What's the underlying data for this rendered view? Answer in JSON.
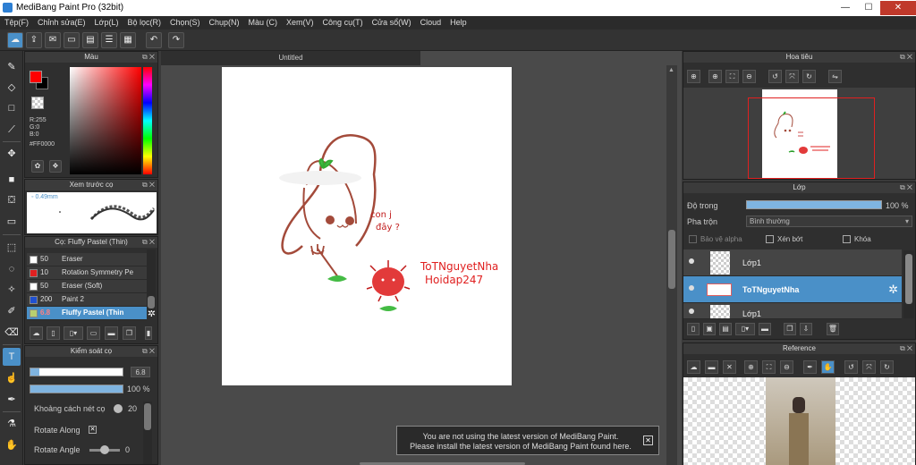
{
  "window": {
    "title": "MediBang Paint Pro (32bit)",
    "minimize": "—",
    "maximize": "☐",
    "close": "✕"
  },
  "menu": [
    "Tệp(F)",
    "Chỉnh sửa(E)",
    "Lớp(L)",
    "Bộ lọc(R)",
    "Chọn(S)",
    "Chụp(N)",
    "Màu (C)",
    "Xem(V)",
    "Công cụ(T)",
    "Cửa sổ(W)",
    "Cloud",
    "Help"
  ],
  "color_panel": {
    "title": "Màu",
    "rgb": {
      "r": "R:255",
      "g": "G:0",
      "b": "B:0",
      "hex": "#FF0000"
    },
    "foreground": "#ff0000",
    "background": "#000000"
  },
  "brush_preview": {
    "title": "Xem trước cọ",
    "size": "0.49mm"
  },
  "brush_panel": {
    "title": "Cọ: Fluffy Pastel (Thin)",
    "brushes": [
      {
        "size": "50",
        "name": "Eraser",
        "color": "#ffffff"
      },
      {
        "size": "10",
        "name": "Rotation Symmetry Pe",
        "color": "#e02020"
      },
      {
        "size": "50",
        "name": "Eraser (Soft)",
        "color": "#ffffff"
      },
      {
        "size": "200",
        "name": "Paint 2",
        "color": "#2050d0"
      },
      {
        "size": "6.8",
        "name": "Fluffy Pastel (Thin",
        "color": "#b8d070"
      }
    ]
  },
  "brush_control": {
    "title": "Kiểm soát cọ",
    "size_value": "6.8",
    "size_fraction": 0.1,
    "opacity_value": "100 %",
    "opacity_fraction": 1.0,
    "spacing_label": "Khoảng cách nét cọ",
    "spacing_value": "20",
    "rotate_along_label": "Rotate Along",
    "rotate_along_checked": "✕",
    "rotate_angle_label": "Rotate Angle",
    "rotate_angle_value": "0"
  },
  "canvas": {
    "tab_title": "Untitled",
    "art_text_1": "ToTNguyetNha",
    "art_text_2": "Hoidap247",
    "bubble_text_1": "con j",
    "bubble_text_2": "đây ?"
  },
  "notice": {
    "line1": "You are not using the latest version of MediBang Paint.",
    "line2": "Please install the latest version of MediBang Paint found here.",
    "close": "✕"
  },
  "navigator": {
    "title": "Hoa tiêu"
  },
  "layers": {
    "title": "Lớp",
    "opacity_label": "Độ trong",
    "opacity_value": "100 %",
    "blend_label": "Pha trộn",
    "blend_value": "Bình thường",
    "protect_alpha": "Bảo vệ alpha",
    "clipping": "Xén bớt",
    "lock": "Khóa",
    "items": [
      {
        "name": "Lớp1"
      },
      {
        "name": "ToTNguyetNha"
      },
      {
        "name": "Lớp1"
      }
    ]
  },
  "reference": {
    "title": "Reference"
  }
}
